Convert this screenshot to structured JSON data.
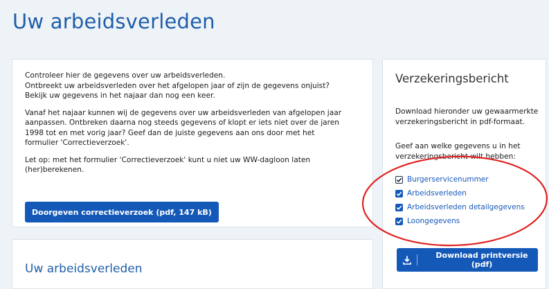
{
  "page": {
    "title": "Uw arbeidsverleden"
  },
  "main": {
    "paragraphs": [
      [
        "Controleer hier de gegevens over uw arbeidsverleden.",
        "Ontbreekt uw arbeidsverleden over het afgelopen jaar of zijn de gegevens onjuist?",
        "Bekijk uw gegevens in het najaar dan nog een keer."
      ],
      [
        "Vanaf het najaar kunnen wij de gegevens over uw arbeidsverleden van afgelopen jaar",
        "aanpassen. Ontbreken daarna nog steeds gegevens of klopt er iets niet over de jaren",
        "1998 tot en met vorig jaar? Geef dan de juiste gegevens aan ons door met het",
        "formulier 'Correctieverzoek'."
      ],
      [
        "Let op: met het formulier 'Correctieverzoek' kunt u niet uw WW-dagloon laten",
        "(her)berekenen."
      ]
    ],
    "button_label": "Doorgeven correctieverzoek (pdf, 147 kB)"
  },
  "history": {
    "title": "Uw arbeidsverleden"
  },
  "sidebar": {
    "title": "Verzekeringsbericht",
    "description": [
      "Download hieronder uw gewaarmerkte",
      "verzekeringsbericht in pdf-formaat."
    ],
    "ask": [
      "Geef aan welke gegevens u in het",
      "verzekeringsbericht wilt hebben:"
    ],
    "checkboxes": [
      {
        "label": "Burgerservicenummer",
        "checked": true
      },
      {
        "label": "Arbeidsverleden",
        "checked": true
      },
      {
        "label": "Arbeidsverleden detailgegevens",
        "checked": true
      },
      {
        "label": "Loongegevens",
        "checked": true
      }
    ],
    "download_label": "Download printversie (pdf)"
  },
  "colors": {
    "primary": "#1559b8",
    "title_blue": "#1f5ea8",
    "annotation_red": "#e02020",
    "background": "#eef3f8"
  },
  "icons": {
    "checkbox": "checkmark-icon",
    "download": "download-icon"
  }
}
